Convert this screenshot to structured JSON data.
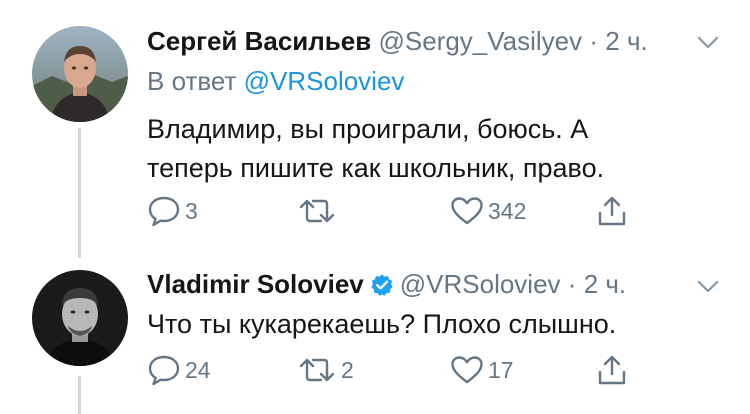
{
  "tweets": [
    {
      "name": "Сергей Васильев",
      "handle": "@Sergy_Vasilyev",
      "separator": "·",
      "time": "2 ч.",
      "reply_prefix": "В ответ ",
      "reply_mention": "@VRSoloviev",
      "text_line1": "Владимир, вы проиграли, боюсь. А",
      "text_line2": "теперь пишите как школьник, право.",
      "replies": "3",
      "retweets": "",
      "likes": "342",
      "verified": false
    },
    {
      "name": "Vladimir Soloviev",
      "handle": "@VRSoloviev",
      "separator": "·",
      "time": "2 ч.",
      "text_line1": "Что ты кукарекаешь? Плохо слышно.",
      "replies": "24",
      "retweets": "2",
      "likes": "17",
      "verified": true
    }
  ],
  "icons": {
    "reply": "speech-bubble-icon",
    "retweet": "retweet-icon",
    "like": "heart-icon",
    "share": "share-icon",
    "more": "chevron-down-icon",
    "verified": "verified-badge-icon"
  },
  "colors": {
    "name": "#14171a",
    "secondary": "#657786",
    "link": "#1b95e0",
    "verified": "#1da1f2",
    "thread_line": "#cfd6dc"
  }
}
